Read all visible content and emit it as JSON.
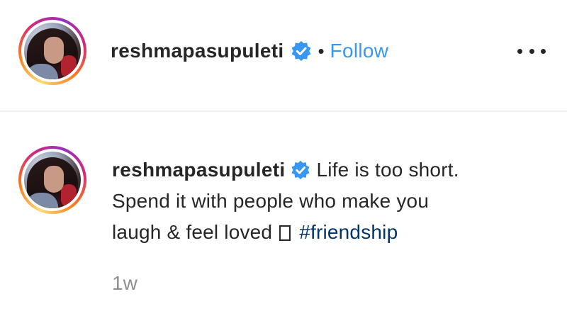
{
  "header": {
    "username": "reshmapasupuleti",
    "separator": "•",
    "follow_label": "Follow",
    "more_icon": "more-horizontal-icon"
  },
  "caption": {
    "username": "reshmapasupuleti",
    "text_line1": "Life is too short.",
    "text_line2": "Spend it with people who make you",
    "text_line3": "laugh & feel loved",
    "hashtag": "#friendship"
  },
  "timestamp": "1w",
  "colors": {
    "follow_blue": "#3897f0",
    "verified_blue": "#3897f0",
    "hashtag": "#003569",
    "muted": "#8e8e8e",
    "text": "#262626"
  }
}
